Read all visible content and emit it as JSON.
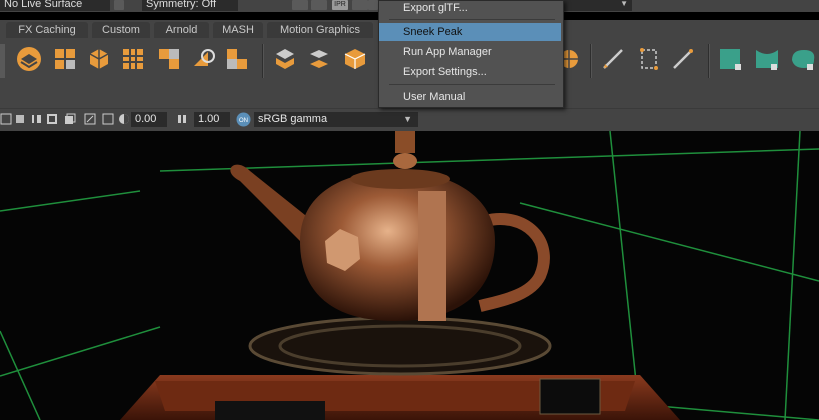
{
  "status_bar": {
    "live_surface": "No Live Surface",
    "symmetry": "Symmetry: Off",
    "ipr_label": "IPR"
  },
  "shelf_tabs": [
    "FX Caching",
    "Custom",
    "Arnold",
    "MASH",
    "Motion Graphics"
  ],
  "viewport_toolbar": {
    "exposure": "0.00",
    "gamma": "1.00",
    "color_space": "sRGB gamma"
  },
  "menu": {
    "items": [
      {
        "label": "Export glTF...",
        "active": false
      },
      {
        "label": "Sneek Peak",
        "active": true
      },
      {
        "label": "Run App Manager",
        "active": false
      },
      {
        "label": "Export Settings...",
        "active": false
      },
      {
        "label": "User Manual",
        "active": false
      }
    ]
  },
  "colors": {
    "panel": "#444444",
    "field": "#2b2b2b",
    "menu_bg": "#525252",
    "menu_highlight": "#5b8fb8",
    "shelf_orange": "#e89b3c",
    "shelf_teal": "#3aa08a",
    "grid_green": "#1f8f3c"
  }
}
